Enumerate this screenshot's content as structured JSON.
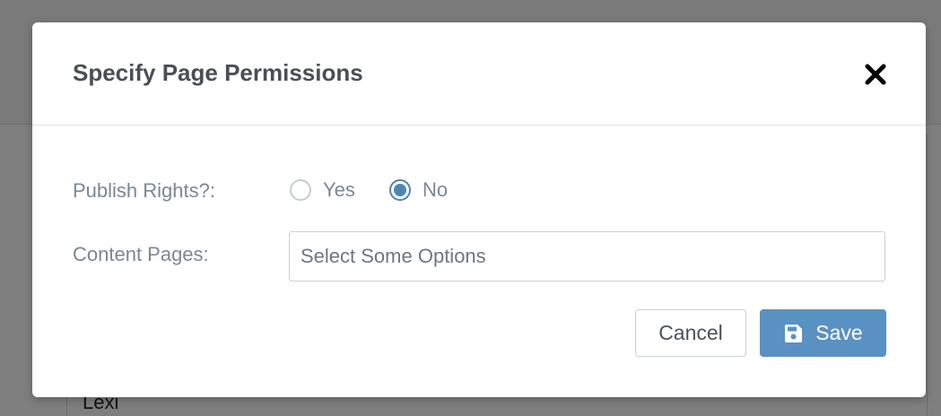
{
  "background": {
    "visible_text": "Lexi"
  },
  "modal": {
    "title": "Specify Page Permissions",
    "close_icon": "close-icon",
    "publish_rights": {
      "label": "Publish Rights?:",
      "options": [
        {
          "label": "Yes",
          "checked": false
        },
        {
          "label": "No",
          "checked": true
        }
      ]
    },
    "content_pages": {
      "label": "Content Pages:",
      "placeholder": "Select Some Options",
      "value": ""
    },
    "buttons": {
      "cancel_label": "Cancel",
      "save_label": "Save",
      "save_icon": "floppy-disk-icon"
    }
  },
  "colors": {
    "primary": "#5a91c3",
    "radio_checked": "#4e85b6",
    "label_text": "#7b8894",
    "title_text": "#4a4f55",
    "overlay": "#7f7f7f"
  }
}
